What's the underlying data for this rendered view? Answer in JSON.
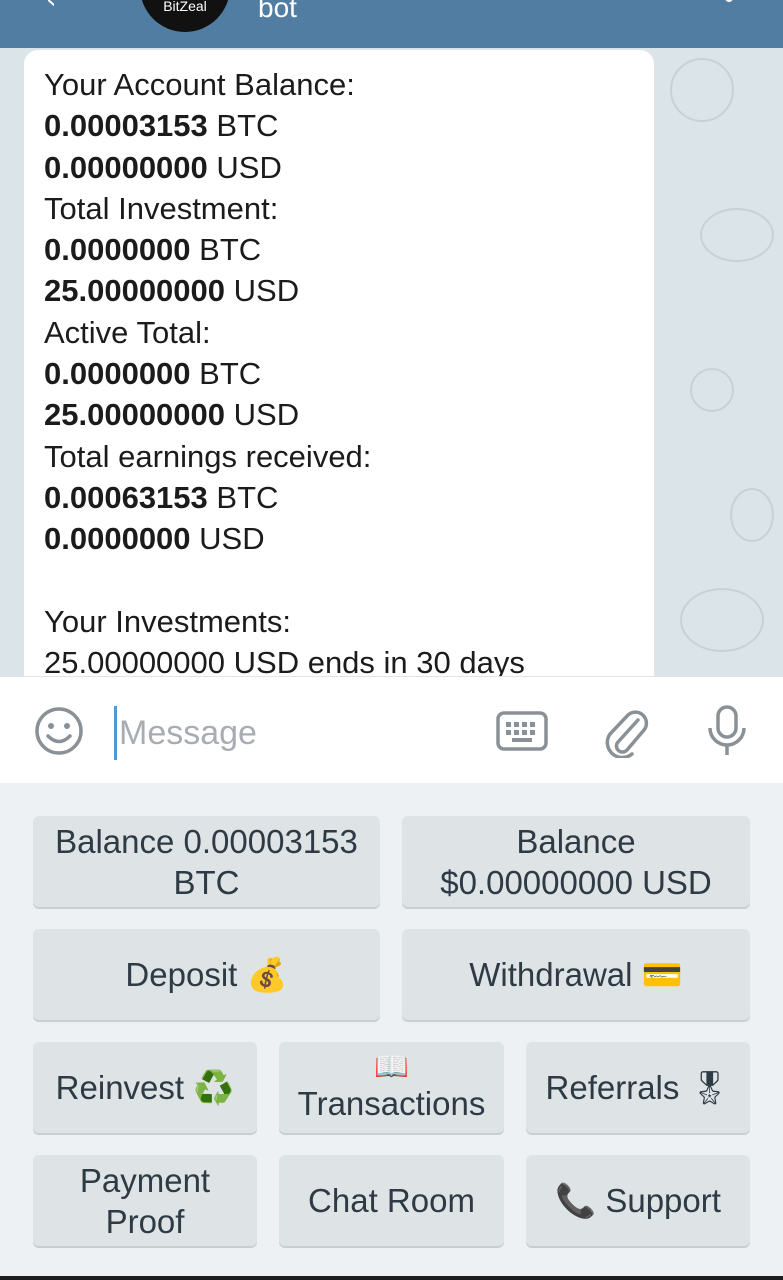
{
  "header": {
    "avatar_text": "BitZeal",
    "title": "bot"
  },
  "message": {
    "lines": [
      {
        "bold": "",
        "text": "Your Account Balance:"
      },
      {
        "bold": "0.00003153",
        "text": " BTC"
      },
      {
        "bold": "0.00000000",
        "text": " USD"
      },
      {
        "bold": "",
        "text": "Total Investment:"
      },
      {
        "bold": "0.0000000",
        "text": " BTC"
      },
      {
        "bold": "25.00000000",
        "text": " USD"
      },
      {
        "bold": "",
        "text": "Active Total:"
      },
      {
        "bold": "0.0000000",
        "text": " BTC"
      },
      {
        "bold": "25.00000000",
        "text": " USD"
      },
      {
        "bold": "",
        "text": "Total earnings received:"
      },
      {
        "bold": "0.00063153",
        "text": " BTC"
      },
      {
        "bold": "0.0000000",
        "text": " USD"
      },
      {
        "bold": "",
        "text": " "
      },
      {
        "bold": "",
        "text": "Your Investments:"
      },
      {
        "bold": "",
        "text": "25.00000000 USD ends in 30 days"
      }
    ]
  },
  "input": {
    "placeholder": "Message"
  },
  "icons": {
    "emoji": "smile-icon",
    "keyboard": "keyboard-icon",
    "attach": "paperclip-icon",
    "mic": "microphone-icon"
  },
  "keyboard_buttons": {
    "balance_btc_line1": "Balance 0.00003153",
    "balance_btc_line2": "BTC",
    "balance_usd_line1": "Balance",
    "balance_usd_line2": "$0.00000000 USD",
    "deposit": "Deposit",
    "deposit_emoji": "💰",
    "withdrawal": "Withdrawal",
    "withdrawal_emoji": "💳",
    "reinvest": "Reinvest",
    "reinvest_emoji": "♻️",
    "transactions_emoji": "📖",
    "transactions": "Transactions",
    "referrals": "Referrals",
    "referrals_emoji": "🎖",
    "payment_proof_line1": "Payment",
    "payment_proof_line2": "Proof",
    "chat_room": "Chat Room",
    "support_emoji": "📞",
    "support": "Support"
  }
}
